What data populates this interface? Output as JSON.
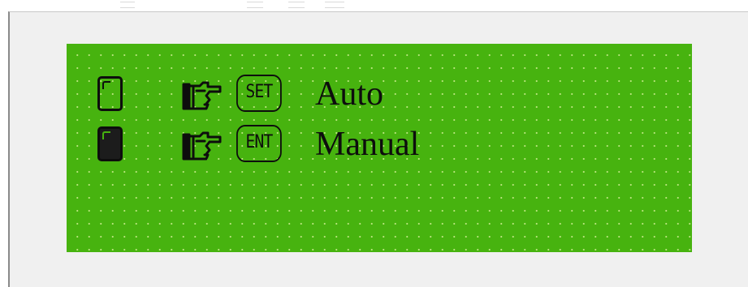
{
  "lcd": {
    "background_color": "#47b30f",
    "foreground_color": "#0d0d0d",
    "rows": [
      {
        "key": "SET",
        "label": "Auto",
        "selected": false,
        "key_icon": "pointing-hand-icon"
      },
      {
        "key": "ENT",
        "label": "Manual",
        "selected": true,
        "key_icon": "pointing-hand-icon"
      }
    ]
  }
}
